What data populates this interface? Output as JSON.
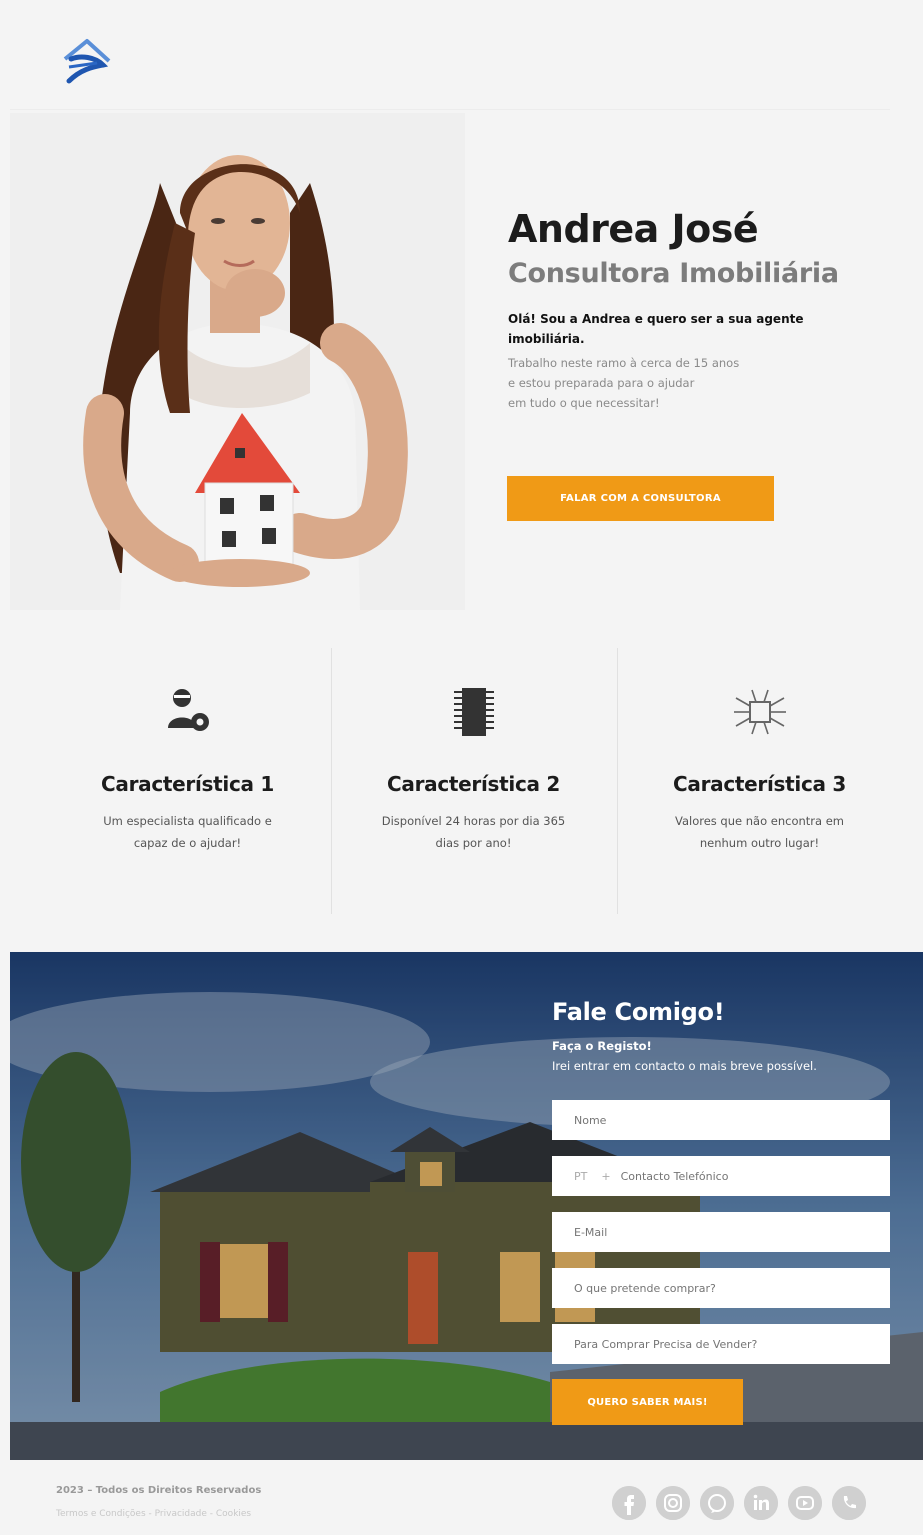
{
  "header": {
    "logo_alt": "house-logo"
  },
  "hero": {
    "name": "Andrea José",
    "role": "Consultora Imobiliária",
    "intro": "Olá! Sou a Andrea e quero ser a sua agente imobiliária.",
    "description": "Trabalho neste ramo à cerca de 15 anos\ne estou preparada para o ajudar\nem tudo o que necessitar!",
    "cta_label": "FALAR COM A CONSULTORA"
  },
  "features": [
    {
      "icon": "specialist-gear-icon",
      "title": "Característica 1",
      "desc": "Um especialista qualificado e capaz de o ajudar!"
    },
    {
      "icon": "chip-icon",
      "title": "Característica 2",
      "desc": "Disponível 24 horas por dia 365 dias por ano!"
    },
    {
      "icon": "network-icon",
      "title": "Característica 3",
      "desc": "Valores que não encontra em nenhum outro lugar!"
    }
  ],
  "contact": {
    "title": "Fale Comigo!",
    "subtitle1": "Faça o Registo!",
    "subtitle2": "Irei entrar em contacto o mais breve possível.",
    "fields": {
      "name_placeholder": "Nome",
      "phone_prefix": "PT",
      "phone_plus": "+",
      "phone_placeholder": "Contacto Telefónico",
      "email_placeholder": "E-Mail",
      "buy_placeholder": "O que pretende comprar?",
      "sell_placeholder": "Para Comprar Precisa de Vender?"
    },
    "submit_label": "QUERO SABER MAIS!"
  },
  "footer": {
    "copyright": "2023 – Todos os Direitos Reservados",
    "links": [
      "Termos e Condições",
      "Privacidade",
      "Cookies"
    ],
    "link_separator": " - ",
    "socials": [
      "facebook-icon",
      "instagram-icon",
      "whatsapp-icon",
      "linkedin-icon",
      "youtube-icon",
      "phone-icon"
    ]
  },
  "colors": {
    "accent": "#f09a16",
    "background": "#f4f4f4",
    "heading": "#1c1c1c",
    "role": "#7c7c7c"
  }
}
